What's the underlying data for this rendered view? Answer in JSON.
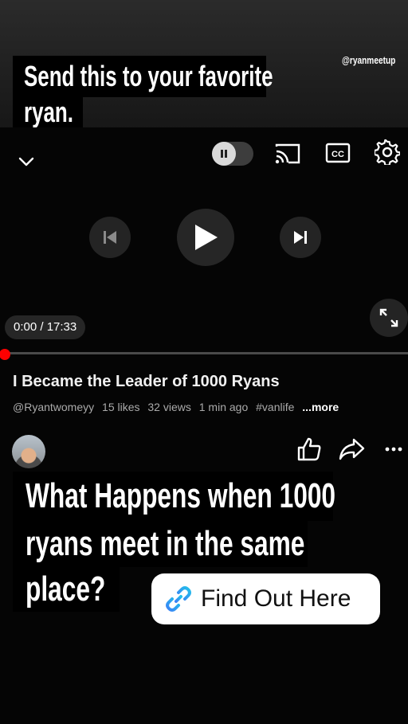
{
  "story": {
    "handle": "@ryanmeetup",
    "caption_top_line1": "Send this to your favorite",
    "caption_top_line2": "ryan.",
    "caption_bottom_line1": "What Happens when 1000",
    "caption_bottom_line2": "ryans meet in the same",
    "caption_bottom_line3": "place?",
    "link_sticker_label": "Find Out Here"
  },
  "player": {
    "time_display": "0:00 / 17:33",
    "progress_fraction": 0.01,
    "accent_color": "#ff0000",
    "icons": [
      "chevron-down-icon",
      "pause-icon",
      "cast-icon",
      "captions-icon",
      "settings-icon",
      "previous-icon",
      "play-icon",
      "next-icon",
      "fullscreen-icon"
    ]
  },
  "video": {
    "title": "I Became the Leader of 1000 Ryans",
    "channel": "@Ryantwomeyy",
    "likes": "15 likes",
    "views": "32 views",
    "age": "1 min ago",
    "hashtag": "#vanlife",
    "more": "...more"
  },
  "actions": [
    "like-icon",
    "share-icon",
    "more-icon"
  ]
}
